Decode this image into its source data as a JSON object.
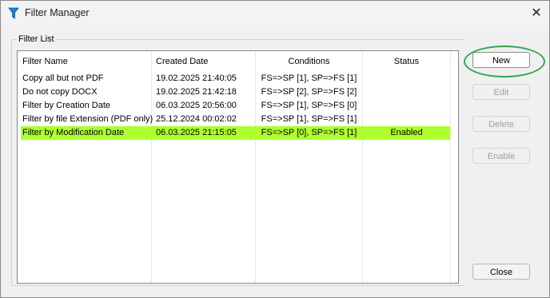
{
  "window": {
    "title": "Filter Manager",
    "close_glyph": "✕",
    "icon": "funnel-icon"
  },
  "group": {
    "label": "Filter List"
  },
  "table": {
    "columns": [
      "Filter Name",
      "Created Date",
      "Conditions",
      "Status"
    ],
    "rows": [
      {
        "name": "Copy all but not PDF",
        "created": "19.02.2025 21:40:05",
        "conditions": "FS=>SP [1], SP=>FS [1]",
        "status": ""
      },
      {
        "name": "Do not copy DOCX",
        "created": "19.02.2025 21:42:18",
        "conditions": "FS=>SP [2], SP=>FS [2]",
        "status": ""
      },
      {
        "name": "Filter by Creation Date",
        "created": "06.03.2025 20:56:00",
        "conditions": "FS=>SP [1], SP=>FS [0]",
        "status": ""
      },
      {
        "name": "Filter by file Extension (PDF only)",
        "created": "25.12.2024 00:02:02",
        "conditions": "FS=>SP [1], SP=>FS [1]",
        "status": ""
      },
      {
        "name": "Filter by Modification Date",
        "created": "06.03.2025 21:15:05",
        "conditions": "FS=>SP [0], SP=>FS [1]",
        "status": "Enabled",
        "selected": true
      }
    ]
  },
  "buttons": {
    "new": "New",
    "edit": "Edit",
    "delete": "Delete",
    "enable": "Enable",
    "close": "Close"
  },
  "colors": {
    "selected_row": "#adff2f",
    "annotation_circle": "#2fa84f",
    "icon_blue": "#1e7fd6"
  }
}
